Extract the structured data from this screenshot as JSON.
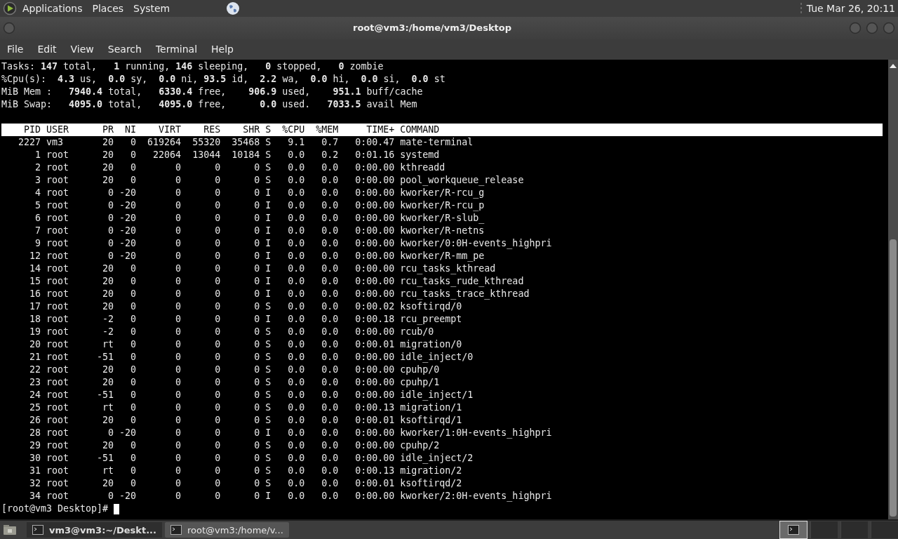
{
  "top_panel": {
    "menus": [
      "Applications",
      "Places",
      "System"
    ],
    "clock": "Tue Mar 26, 20:11"
  },
  "window": {
    "title": "root@vm3:/home/vm3/Desktop",
    "menu": [
      "File",
      "Edit",
      "View",
      "Search",
      "Terminal",
      "Help"
    ]
  },
  "terminal": {
    "summary": [
      "Tasks: **147** total,   **1** running, **146** sleeping,   **0** stopped,   **0** zombie",
      "%Cpu(s):  **4.3** us,  **0.0** sy,  **0.0** ni, **93.5** id,  **2.2** wa,  **0.0** hi,  **0.0** si,  **0.0** st",
      "MiB Mem :   **7940.4** total,   **6330.4** free,    **906.9** used,    **951.1** buff/cache",
      "MiB Swap:   **4095.0** total,   **4095.0** free,      **0.0** used.   **7033.5** avail Mem"
    ],
    "columns": [
      "PID",
      "USER",
      "PR",
      "NI",
      "VIRT",
      "RES",
      "SHR",
      "S",
      "%CPU",
      "%MEM",
      "TIME+",
      "COMMAND"
    ],
    "rows": [
      [
        "2227",
        "vm3",
        "20",
        "0",
        "619264",
        "55320",
        "35468",
        "S",
        "9.1",
        "0.7",
        "0:00.47",
        "mate-terminal"
      ],
      [
        "1",
        "root",
        "20",
        "0",
        "22064",
        "13044",
        "10184",
        "S",
        "0.0",
        "0.2",
        "0:01.16",
        "systemd"
      ],
      [
        "2",
        "root",
        "20",
        "0",
        "0",
        "0",
        "0",
        "S",
        "0.0",
        "0.0",
        "0:00.00",
        "kthreadd"
      ],
      [
        "3",
        "root",
        "20",
        "0",
        "0",
        "0",
        "0",
        "S",
        "0.0",
        "0.0",
        "0:00.00",
        "pool_workqueue_release"
      ],
      [
        "4",
        "root",
        "0",
        "-20",
        "0",
        "0",
        "0",
        "I",
        "0.0",
        "0.0",
        "0:00.00",
        "kworker/R-rcu_g"
      ],
      [
        "5",
        "root",
        "0",
        "-20",
        "0",
        "0",
        "0",
        "I",
        "0.0",
        "0.0",
        "0:00.00",
        "kworker/R-rcu_p"
      ],
      [
        "6",
        "root",
        "0",
        "-20",
        "0",
        "0",
        "0",
        "I",
        "0.0",
        "0.0",
        "0:00.00",
        "kworker/R-slub_"
      ],
      [
        "7",
        "root",
        "0",
        "-20",
        "0",
        "0",
        "0",
        "I",
        "0.0",
        "0.0",
        "0:00.00",
        "kworker/R-netns"
      ],
      [
        "9",
        "root",
        "0",
        "-20",
        "0",
        "0",
        "0",
        "I",
        "0.0",
        "0.0",
        "0:00.00",
        "kworker/0:0H-events_highpri"
      ],
      [
        "12",
        "root",
        "0",
        "-20",
        "0",
        "0",
        "0",
        "I",
        "0.0",
        "0.0",
        "0:00.00",
        "kworker/R-mm_pe"
      ],
      [
        "14",
        "root",
        "20",
        "0",
        "0",
        "0",
        "0",
        "I",
        "0.0",
        "0.0",
        "0:00.00",
        "rcu_tasks_kthread"
      ],
      [
        "15",
        "root",
        "20",
        "0",
        "0",
        "0",
        "0",
        "I",
        "0.0",
        "0.0",
        "0:00.00",
        "rcu_tasks_rude_kthread"
      ],
      [
        "16",
        "root",
        "20",
        "0",
        "0",
        "0",
        "0",
        "I",
        "0.0",
        "0.0",
        "0:00.00",
        "rcu_tasks_trace_kthread"
      ],
      [
        "17",
        "root",
        "20",
        "0",
        "0",
        "0",
        "0",
        "S",
        "0.0",
        "0.0",
        "0:00.02",
        "ksoftirqd/0"
      ],
      [
        "18",
        "root",
        "-2",
        "0",
        "0",
        "0",
        "0",
        "I",
        "0.0",
        "0.0",
        "0:00.18",
        "rcu_preempt"
      ],
      [
        "19",
        "root",
        "-2",
        "0",
        "0",
        "0",
        "0",
        "S",
        "0.0",
        "0.0",
        "0:00.00",
        "rcub/0"
      ],
      [
        "20",
        "root",
        "rt",
        "0",
        "0",
        "0",
        "0",
        "S",
        "0.0",
        "0.0",
        "0:00.01",
        "migration/0"
      ],
      [
        "21",
        "root",
        "-51",
        "0",
        "0",
        "0",
        "0",
        "S",
        "0.0",
        "0.0",
        "0:00.00",
        "idle_inject/0"
      ],
      [
        "22",
        "root",
        "20",
        "0",
        "0",
        "0",
        "0",
        "S",
        "0.0",
        "0.0",
        "0:00.00",
        "cpuhp/0"
      ],
      [
        "23",
        "root",
        "20",
        "0",
        "0",
        "0",
        "0",
        "S",
        "0.0",
        "0.0",
        "0:00.00",
        "cpuhp/1"
      ],
      [
        "24",
        "root",
        "-51",
        "0",
        "0",
        "0",
        "0",
        "S",
        "0.0",
        "0.0",
        "0:00.00",
        "idle_inject/1"
      ],
      [
        "25",
        "root",
        "rt",
        "0",
        "0",
        "0",
        "0",
        "S",
        "0.0",
        "0.0",
        "0:00.13",
        "migration/1"
      ],
      [
        "26",
        "root",
        "20",
        "0",
        "0",
        "0",
        "0",
        "S",
        "0.0",
        "0.0",
        "0:00.01",
        "ksoftirqd/1"
      ],
      [
        "28",
        "root",
        "0",
        "-20",
        "0",
        "0",
        "0",
        "I",
        "0.0",
        "0.0",
        "0:00.00",
        "kworker/1:0H-events_highpri"
      ],
      [
        "29",
        "root",
        "20",
        "0",
        "0",
        "0",
        "0",
        "S",
        "0.0",
        "0.0",
        "0:00.00",
        "cpuhp/2"
      ],
      [
        "30",
        "root",
        "-51",
        "0",
        "0",
        "0",
        "0",
        "S",
        "0.0",
        "0.0",
        "0:00.00",
        "idle_inject/2"
      ],
      [
        "31",
        "root",
        "rt",
        "0",
        "0",
        "0",
        "0",
        "S",
        "0.0",
        "0.0",
        "0:00.13",
        "migration/2"
      ],
      [
        "32",
        "root",
        "20",
        "0",
        "0",
        "0",
        "0",
        "S",
        "0.0",
        "0.0",
        "0:00.01",
        "ksoftirqd/2"
      ],
      [
        "34",
        "root",
        "0",
        "-20",
        "0",
        "0",
        "0",
        "I",
        "0.0",
        "0.0",
        "0:00.00",
        "kworker/2:0H-events_highpri"
      ]
    ],
    "prompt": "[root@vm3 Desktop]#"
  },
  "taskbar": {
    "tasks": [
      {
        "label": "vm3@vm3:~/Deskt...",
        "selected": false
      },
      {
        "label": "root@vm3:/home/v...",
        "selected": true
      }
    ]
  }
}
